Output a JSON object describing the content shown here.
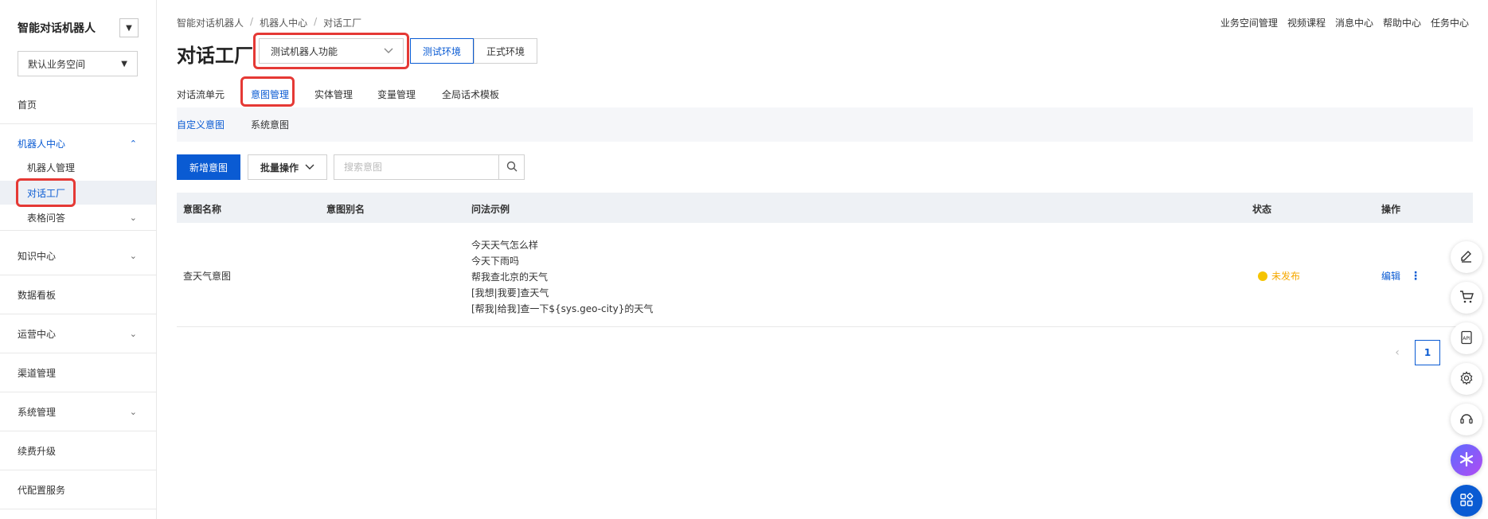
{
  "sidebar": {
    "title": "智能对话机器人",
    "workspace": "默认业务空间",
    "items": {
      "home": "首页",
      "robot_center": "机器人中心",
      "robot_manage": "机器人管理",
      "dialog_factory": "对话工厂",
      "table_qa": "表格问答",
      "knowledge": "知识中心",
      "dashboard": "数据看板",
      "operations": "运营中心",
      "channels": "渠道管理",
      "system": "系统管理",
      "renew": "续费升级",
      "config_service": "代配置服务"
    }
  },
  "breadcrumb": [
    "智能对话机器人",
    "机器人中心",
    "对话工厂"
  ],
  "topnav": [
    "业务空间管理",
    "视频课程",
    "消息中心",
    "帮助中心",
    "任务中心"
  ],
  "page": {
    "title": "对话工厂",
    "robot_select": "测试机器人功能",
    "env_test": "测试环境",
    "env_prod": "正式环境"
  },
  "tabs": [
    "对话流单元",
    "意图管理",
    "实体管理",
    "变量管理",
    "全局话术模板"
  ],
  "subtabs": [
    "自定义意图",
    "系统意图"
  ],
  "toolbar": {
    "add": "新增意图",
    "batch": "批量操作",
    "search_placeholder": "搜索意图"
  },
  "table": {
    "headers": [
      "意图名称",
      "意图别名",
      "问法示例",
      "状态",
      "操作"
    ],
    "rows": [
      {
        "name": "查天气意图",
        "alias": "",
        "examples": [
          "今天天气怎么样",
          "今天下雨吗",
          "帮我查北京的天气",
          "[我想|我要]查天气",
          "[帮我|给我]查一下${sys.geo-city}的天气"
        ],
        "status": "未发布",
        "op_edit": "编辑"
      }
    ]
  },
  "pagination": {
    "current": "1"
  },
  "colors": {
    "primary": "#0a5bd3",
    "highlight": "#e53935",
    "status_pending": "#f5c400"
  }
}
